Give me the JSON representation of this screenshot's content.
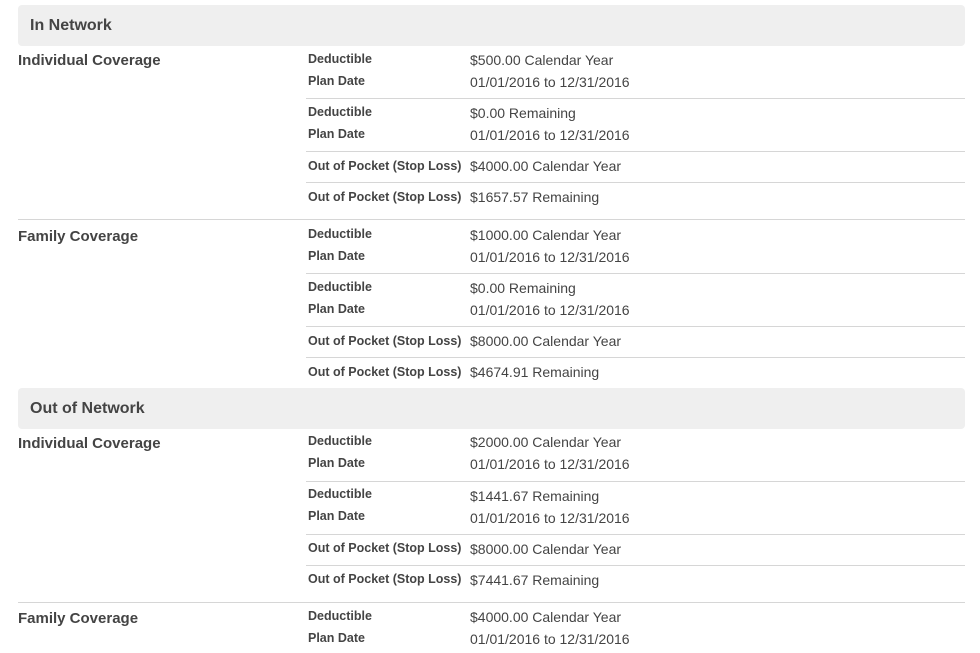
{
  "sections": [
    {
      "title": "In Network",
      "coverages": [
        {
          "label": "Individual Coverage",
          "groups": [
            [
              {
                "label": "Deductible",
                "value": "$500.00 Calendar Year"
              },
              {
                "label": "Plan Date",
                "value": "01/01/2016 to 12/31/2016"
              }
            ],
            [
              {
                "label": "Deductible",
                "value": "$0.00 Remaining"
              },
              {
                "label": "Plan Date",
                "value": "01/01/2016 to 12/31/2016"
              }
            ],
            [
              {
                "label": "Out of Pocket (Stop Loss)",
                "value": "$4000.00 Calendar Year"
              }
            ],
            [
              {
                "label": "Out of Pocket (Stop Loss)",
                "value": "$1657.57 Remaining"
              }
            ]
          ]
        },
        {
          "label": "Family Coverage",
          "groups": [
            [
              {
                "label": "Deductible",
                "value": "$1000.00 Calendar Year"
              },
              {
                "label": "Plan Date",
                "value": "01/01/2016 to 12/31/2016"
              }
            ],
            [
              {
                "label": "Deductible",
                "value": "$0.00 Remaining"
              },
              {
                "label": "Plan Date",
                "value": "01/01/2016 to 12/31/2016"
              }
            ],
            [
              {
                "label": "Out of Pocket (Stop Loss)",
                "value": "$8000.00 Calendar Year"
              }
            ],
            [
              {
                "label": "Out of Pocket (Stop Loss)",
                "value": "$4674.91 Remaining"
              }
            ]
          ]
        }
      ]
    },
    {
      "title": "Out of Network",
      "coverages": [
        {
          "label": "Individual Coverage",
          "groups": [
            [
              {
                "label": "Deductible",
                "value": "$2000.00 Calendar Year"
              },
              {
                "label": "Plan Date",
                "value": "01/01/2016 to 12/31/2016"
              }
            ],
            [
              {
                "label": "Deductible",
                "value": "$1441.67 Remaining"
              },
              {
                "label": "Plan Date",
                "value": "01/01/2016 to 12/31/2016"
              }
            ],
            [
              {
                "label": "Out of Pocket (Stop Loss)",
                "value": "$8000.00 Calendar Year"
              }
            ],
            [
              {
                "label": "Out of Pocket (Stop Loss)",
                "value": "$7441.67 Remaining"
              }
            ]
          ]
        },
        {
          "label": "Family Coverage",
          "groups": [
            [
              {
                "label": "Deductible",
                "value": "$4000.00 Calendar Year"
              },
              {
                "label": "Plan Date",
                "value": "01/01/2016 to 12/31/2016"
              }
            ]
          ]
        }
      ]
    }
  ]
}
